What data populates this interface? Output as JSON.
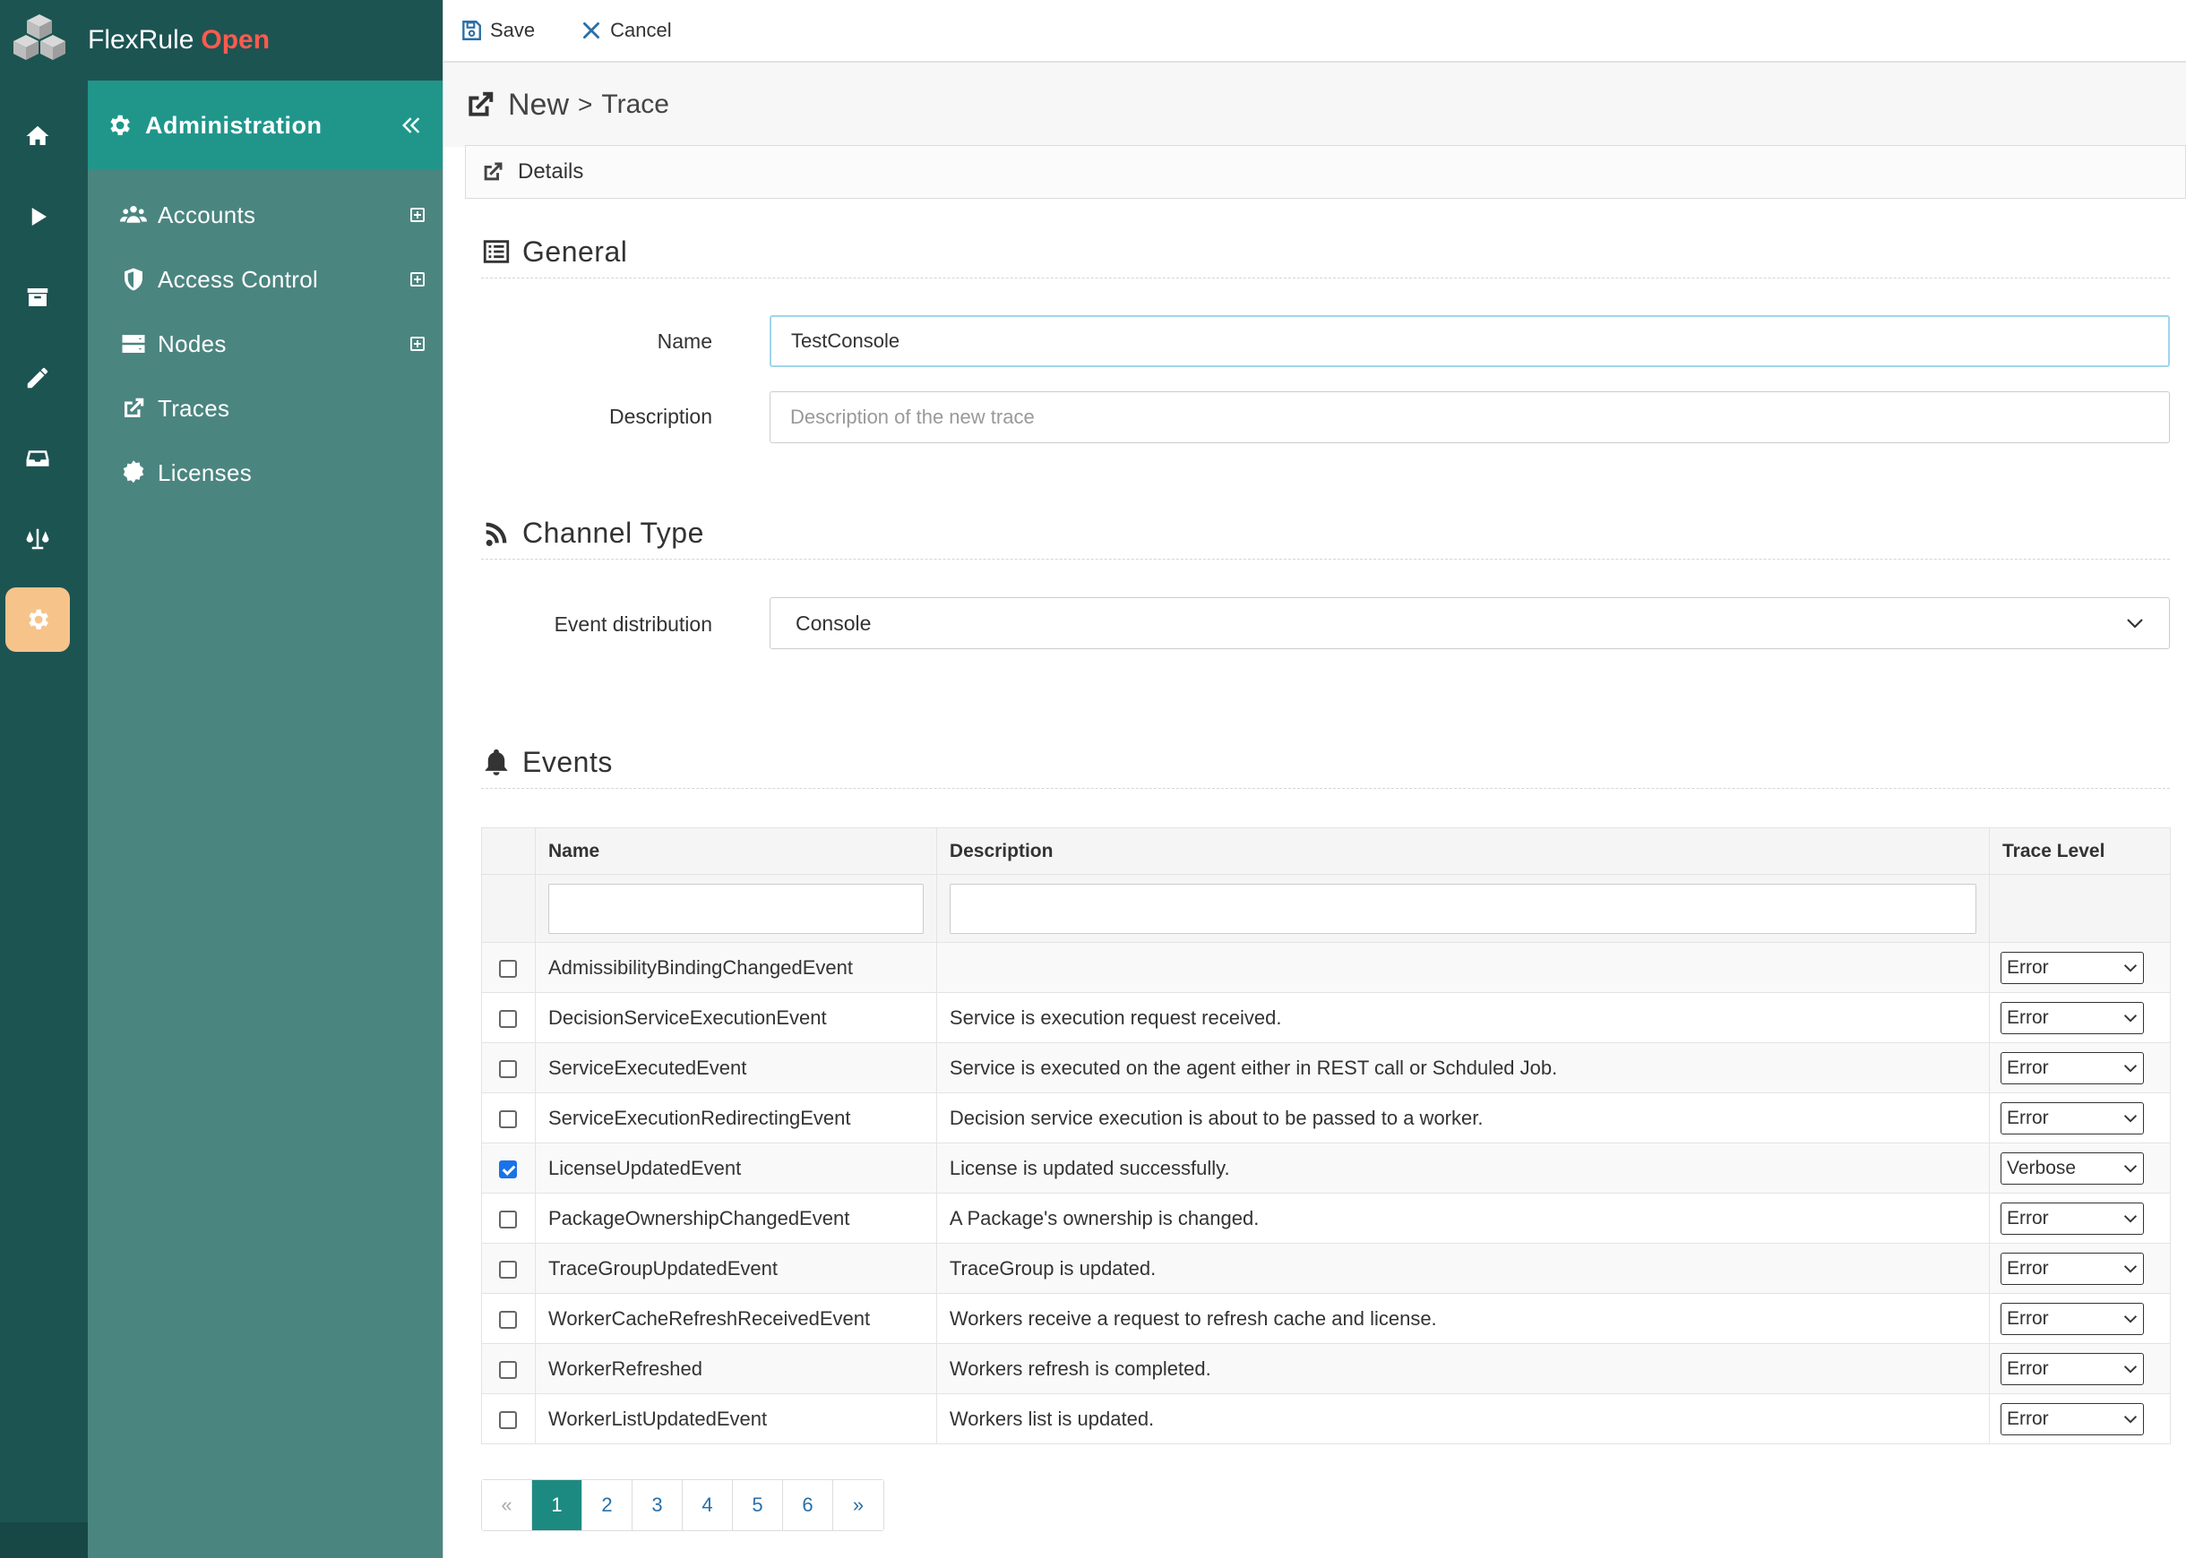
{
  "app": {
    "brand_name": "FlexRule",
    "brand_accent": "Open"
  },
  "rail": {
    "items": [
      {
        "icon": "home-icon"
      },
      {
        "icon": "play-icon"
      },
      {
        "icon": "archive-icon"
      },
      {
        "icon": "pencil-icon"
      },
      {
        "icon": "inbox-icon"
      },
      {
        "icon": "scale-icon"
      },
      {
        "icon": "gear-icon",
        "active": true
      }
    ]
  },
  "sidebar": {
    "header": "Administration",
    "items": [
      {
        "label": "Accounts",
        "icon": "users-icon",
        "expandable": true
      },
      {
        "label": "Access Control",
        "icon": "shield-icon",
        "expandable": true
      },
      {
        "label": "Nodes",
        "icon": "server-icon",
        "expandable": true
      },
      {
        "label": "Traces",
        "icon": "external-link-icon",
        "expandable": false
      },
      {
        "label": "Licenses",
        "icon": "certificate-icon",
        "expandable": false
      }
    ]
  },
  "toolbar": {
    "save_label": "Save",
    "cancel_label": "Cancel"
  },
  "breadcrumb": {
    "new": "New",
    "separator": ">",
    "current": "Trace"
  },
  "details_tab": "Details",
  "general": {
    "title": "General",
    "name_label": "Name",
    "name_value": "TestConsole",
    "description_label": "Description",
    "description_placeholder": "Description of the new trace"
  },
  "channel": {
    "title": "Channel Type",
    "event_distribution_label": "Event distribution",
    "event_distribution_value": "Console"
  },
  "events": {
    "title": "Events",
    "columns": {
      "name": "Name",
      "description": "Description",
      "trace_level": "Trace Level"
    },
    "rows": [
      {
        "checked": false,
        "name": "AdmissibilityBindingChangedEvent",
        "description": "",
        "level": "Error"
      },
      {
        "checked": false,
        "name": "DecisionServiceExecutionEvent",
        "description": "Service is execution request received.",
        "level": "Error"
      },
      {
        "checked": false,
        "name": "ServiceExecutedEvent",
        "description": "Service is executed on the agent either in REST call or Schduled Job.",
        "level": "Error"
      },
      {
        "checked": false,
        "name": "ServiceExecutionRedirectingEvent",
        "description": "Decision service execution is about to be passed to a worker.",
        "level": "Error"
      },
      {
        "checked": true,
        "name": "LicenseUpdatedEvent",
        "description": "License is updated successfully.",
        "level": "Verbose"
      },
      {
        "checked": false,
        "name": "PackageOwnershipChangedEvent",
        "description": "A Package's ownership is changed.",
        "level": "Error"
      },
      {
        "checked": false,
        "name": "TraceGroupUpdatedEvent",
        "description": "TraceGroup is updated.",
        "level": "Error"
      },
      {
        "checked": false,
        "name": "WorkerCacheRefreshReceivedEvent",
        "description": "Workers receive a request to refresh cache and license.",
        "level": "Error"
      },
      {
        "checked": false,
        "name": "WorkerRefreshed",
        "description": "Workers refresh is completed.",
        "level": "Error"
      },
      {
        "checked": false,
        "name": "WorkerListUpdatedEvent",
        "description": "Workers list is updated.",
        "level": "Error"
      }
    ]
  },
  "pagination": {
    "prev": "«",
    "pages": [
      "1",
      "2",
      "3",
      "4",
      "5",
      "6"
    ],
    "active": "1",
    "next": "»"
  },
  "colors": {
    "rail": "#1c5452",
    "sidebar": "#4b8580",
    "sidebar_header": "#20968b",
    "brand_accent": "#ff5a4e",
    "active_rail": "#f6c38b",
    "active_page": "#1d8a82"
  }
}
